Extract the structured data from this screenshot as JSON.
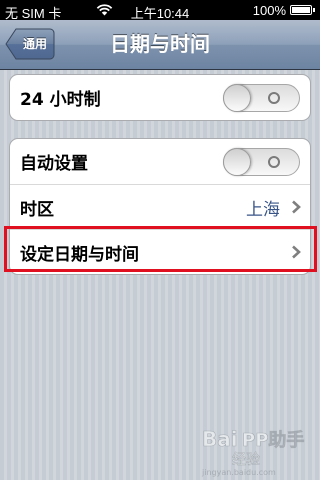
{
  "status_bar": {
    "carrier": "无 SIM 卡",
    "time": "上午10:44",
    "battery": "100%"
  },
  "nav": {
    "back_label": "通用",
    "title": "日期与时间"
  },
  "group1": {
    "rows": [
      {
        "label": "24 小时制",
        "toggle_state": "off"
      }
    ]
  },
  "group2": {
    "rows": [
      {
        "label": "自动设置",
        "toggle_state": "off"
      },
      {
        "label": "时区",
        "value": "上海"
      },
      {
        "label": "设定日期与时间"
      }
    ]
  },
  "watermark": {
    "text": "Baidu 经验",
    "subtext": "jingyan.baidu.com",
    "logo_text": "PP助手"
  },
  "colors": {
    "nav_bar": "#7d92ad",
    "value_text": "#385487",
    "highlight": "#e01020",
    "background": "#cbd2d8"
  }
}
